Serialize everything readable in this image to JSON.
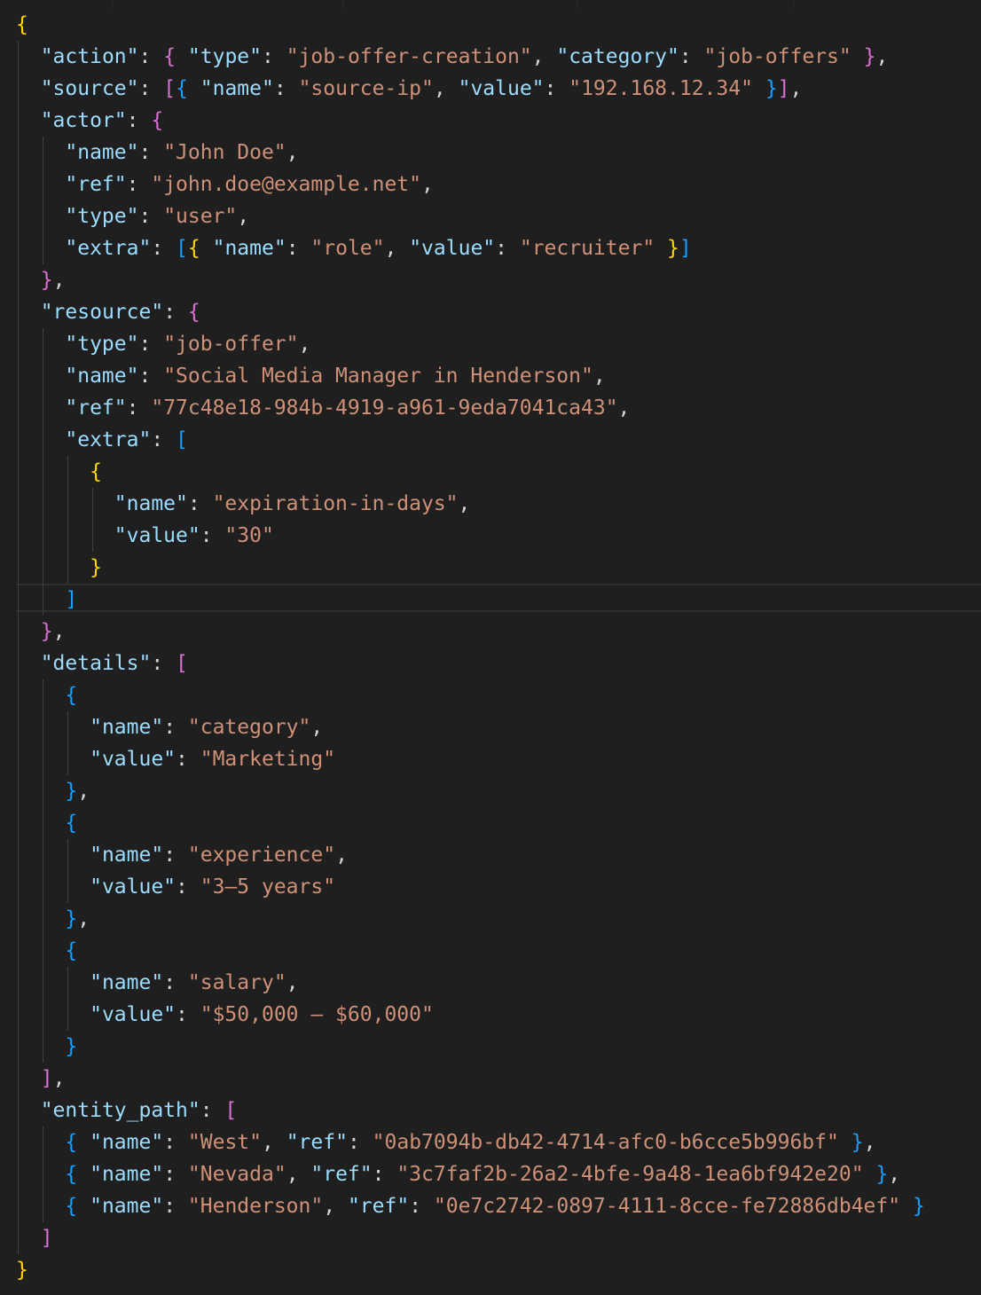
{
  "code": {
    "lines": [
      [
        [
          "b1",
          "{"
        ]
      ],
      [
        [
          "p",
          "  "
        ],
        [
          "k",
          "\"action\""
        ],
        [
          "p",
          ": "
        ],
        [
          "b2",
          "{"
        ],
        [
          "p",
          " "
        ],
        [
          "k",
          "\"type\""
        ],
        [
          "p",
          ": "
        ],
        [
          "s",
          "\"job-offer-creation\""
        ],
        [
          "p",
          ", "
        ],
        [
          "k",
          "\"category\""
        ],
        [
          "p",
          ": "
        ],
        [
          "s",
          "\"job-offers\""
        ],
        [
          "p",
          " "
        ],
        [
          "b2",
          "}"
        ],
        [
          "p",
          ","
        ]
      ],
      [
        [
          "p",
          "  "
        ],
        [
          "k",
          "\"source\""
        ],
        [
          "p",
          ": "
        ],
        [
          "b2",
          "["
        ],
        [
          "b3",
          "{"
        ],
        [
          "p",
          " "
        ],
        [
          "k",
          "\"name\""
        ],
        [
          "p",
          ": "
        ],
        [
          "s",
          "\"source-ip\""
        ],
        [
          "p",
          ", "
        ],
        [
          "k",
          "\"value\""
        ],
        [
          "p",
          ": "
        ],
        [
          "s",
          "\"192.168.12.34\""
        ],
        [
          "p",
          " "
        ],
        [
          "b3",
          "}"
        ],
        [
          "b2",
          "]"
        ],
        [
          "p",
          ","
        ]
      ],
      [
        [
          "p",
          "  "
        ],
        [
          "k",
          "\"actor\""
        ],
        [
          "p",
          ": "
        ],
        [
          "b2",
          "{"
        ]
      ],
      [
        [
          "p",
          "    "
        ],
        [
          "k",
          "\"name\""
        ],
        [
          "p",
          ": "
        ],
        [
          "s",
          "\"John Doe\""
        ],
        [
          "p",
          ","
        ]
      ],
      [
        [
          "p",
          "    "
        ],
        [
          "k",
          "\"ref\""
        ],
        [
          "p",
          ": "
        ],
        [
          "s",
          "\"john.doe@example.net\""
        ],
        [
          "p",
          ","
        ]
      ],
      [
        [
          "p",
          "    "
        ],
        [
          "k",
          "\"type\""
        ],
        [
          "p",
          ": "
        ],
        [
          "s",
          "\"user\""
        ],
        [
          "p",
          ","
        ]
      ],
      [
        [
          "p",
          "    "
        ],
        [
          "k",
          "\"extra\""
        ],
        [
          "p",
          ": "
        ],
        [
          "b3",
          "["
        ],
        [
          "b1",
          "{"
        ],
        [
          "p",
          " "
        ],
        [
          "k",
          "\"name\""
        ],
        [
          "p",
          ": "
        ],
        [
          "s",
          "\"role\""
        ],
        [
          "p",
          ", "
        ],
        [
          "k",
          "\"value\""
        ],
        [
          "p",
          ": "
        ],
        [
          "s",
          "\"recruiter\""
        ],
        [
          "p",
          " "
        ],
        [
          "b1",
          "}"
        ],
        [
          "b3",
          "]"
        ]
      ],
      [
        [
          "p",
          "  "
        ],
        [
          "b2",
          "}"
        ],
        [
          "p",
          ","
        ]
      ],
      [
        [
          "p",
          "  "
        ],
        [
          "k",
          "\"resource\""
        ],
        [
          "p",
          ": "
        ],
        [
          "b2",
          "{"
        ]
      ],
      [
        [
          "p",
          "    "
        ],
        [
          "k",
          "\"type\""
        ],
        [
          "p",
          ": "
        ],
        [
          "s",
          "\"job-offer\""
        ],
        [
          "p",
          ","
        ]
      ],
      [
        [
          "p",
          "    "
        ],
        [
          "k",
          "\"name\""
        ],
        [
          "p",
          ": "
        ],
        [
          "s",
          "\"Social Media Manager in Henderson\""
        ],
        [
          "p",
          ","
        ]
      ],
      [
        [
          "p",
          "    "
        ],
        [
          "k",
          "\"ref\""
        ],
        [
          "p",
          ": "
        ],
        [
          "s",
          "\"77c48e18-984b-4919-a961-9eda7041ca43\""
        ],
        [
          "p",
          ","
        ]
      ],
      [
        [
          "p",
          "    "
        ],
        [
          "k",
          "\"extra\""
        ],
        [
          "p",
          ": "
        ],
        [
          "b3",
          "["
        ]
      ],
      [
        [
          "p",
          "      "
        ],
        [
          "b1",
          "{"
        ]
      ],
      [
        [
          "p",
          "        "
        ],
        [
          "k",
          "\"name\""
        ],
        [
          "p",
          ": "
        ],
        [
          "s",
          "\"expiration-in-days\""
        ],
        [
          "p",
          ","
        ]
      ],
      [
        [
          "p",
          "        "
        ],
        [
          "k",
          "\"value\""
        ],
        [
          "p",
          ": "
        ],
        [
          "s",
          "\"30\""
        ]
      ],
      [
        [
          "p",
          "      "
        ],
        [
          "b1",
          "}"
        ]
      ],
      [
        [
          "p",
          "    "
        ],
        [
          "b3",
          "]"
        ]
      ],
      [
        [
          "p",
          "  "
        ],
        [
          "b2",
          "}"
        ],
        [
          "p",
          ","
        ]
      ],
      [
        [
          "p",
          "  "
        ],
        [
          "k",
          "\"details\""
        ],
        [
          "p",
          ": "
        ],
        [
          "b2",
          "["
        ]
      ],
      [
        [
          "p",
          "    "
        ],
        [
          "b3",
          "{"
        ]
      ],
      [
        [
          "p",
          "      "
        ],
        [
          "k",
          "\"name\""
        ],
        [
          "p",
          ": "
        ],
        [
          "s",
          "\"category\""
        ],
        [
          "p",
          ","
        ]
      ],
      [
        [
          "p",
          "      "
        ],
        [
          "k",
          "\"value\""
        ],
        [
          "p",
          ": "
        ],
        [
          "s",
          "\"Marketing\""
        ]
      ],
      [
        [
          "p",
          "    "
        ],
        [
          "b3",
          "}"
        ],
        [
          "p",
          ","
        ]
      ],
      [
        [
          "p",
          "    "
        ],
        [
          "b3",
          "{"
        ]
      ],
      [
        [
          "p",
          "      "
        ],
        [
          "k",
          "\"name\""
        ],
        [
          "p",
          ": "
        ],
        [
          "s",
          "\"experience\""
        ],
        [
          "p",
          ","
        ]
      ],
      [
        [
          "p",
          "      "
        ],
        [
          "k",
          "\"value\""
        ],
        [
          "p",
          ": "
        ],
        [
          "s",
          "\"3–5 years\""
        ]
      ],
      [
        [
          "p",
          "    "
        ],
        [
          "b3",
          "}"
        ],
        [
          "p",
          ","
        ]
      ],
      [
        [
          "p",
          "    "
        ],
        [
          "b3",
          "{"
        ]
      ],
      [
        [
          "p",
          "      "
        ],
        [
          "k",
          "\"name\""
        ],
        [
          "p",
          ": "
        ],
        [
          "s",
          "\"salary\""
        ],
        [
          "p",
          ","
        ]
      ],
      [
        [
          "p",
          "      "
        ],
        [
          "k",
          "\"value\""
        ],
        [
          "p",
          ": "
        ],
        [
          "s",
          "\"$50,000 – $60,000\""
        ]
      ],
      [
        [
          "p",
          "    "
        ],
        [
          "b3",
          "}"
        ]
      ],
      [
        [
          "p",
          "  "
        ],
        [
          "b2",
          "]"
        ],
        [
          "p",
          ","
        ]
      ],
      [
        [
          "p",
          "  "
        ],
        [
          "k",
          "\"entity_path\""
        ],
        [
          "p",
          ": "
        ],
        [
          "b2",
          "["
        ]
      ],
      [
        [
          "p",
          "    "
        ],
        [
          "b3",
          "{"
        ],
        [
          "p",
          " "
        ],
        [
          "k",
          "\"name\""
        ],
        [
          "p",
          ": "
        ],
        [
          "s",
          "\"West\""
        ],
        [
          "p",
          ", "
        ],
        [
          "k",
          "\"ref\""
        ],
        [
          "p",
          ": "
        ],
        [
          "s",
          "\"0ab7094b-db42-4714-afc0-b6cce5b996bf\""
        ],
        [
          "p",
          " "
        ],
        [
          "b3",
          "}"
        ],
        [
          "p",
          ","
        ]
      ],
      [
        [
          "p",
          "    "
        ],
        [
          "b3",
          "{"
        ],
        [
          "p",
          " "
        ],
        [
          "k",
          "\"name\""
        ],
        [
          "p",
          ": "
        ],
        [
          "s",
          "\"Nevada\""
        ],
        [
          "p",
          ", "
        ],
        [
          "k",
          "\"ref\""
        ],
        [
          "p",
          ": "
        ],
        [
          "s",
          "\"3c7faf2b-26a2-4bfe-9a48-1ea6bf942e20\""
        ],
        [
          "p",
          " "
        ],
        [
          "b3",
          "}"
        ],
        [
          "p",
          ","
        ]
      ],
      [
        [
          "p",
          "    "
        ],
        [
          "b3",
          "{"
        ],
        [
          "p",
          " "
        ],
        [
          "k",
          "\"name\""
        ],
        [
          "p",
          ": "
        ],
        [
          "s",
          "\"Henderson\""
        ],
        [
          "p",
          ", "
        ],
        [
          "k",
          "\"ref\""
        ],
        [
          "p",
          ": "
        ],
        [
          "s",
          "\"0e7c2742-0897-4111-8cce-fe72886db4ef\""
        ],
        [
          "p",
          " "
        ],
        [
          "b3",
          "}"
        ]
      ],
      [
        [
          "p",
          "  "
        ],
        [
          "b2",
          "]"
        ]
      ],
      [
        [
          "b1",
          "}"
        ]
      ]
    ]
  }
}
